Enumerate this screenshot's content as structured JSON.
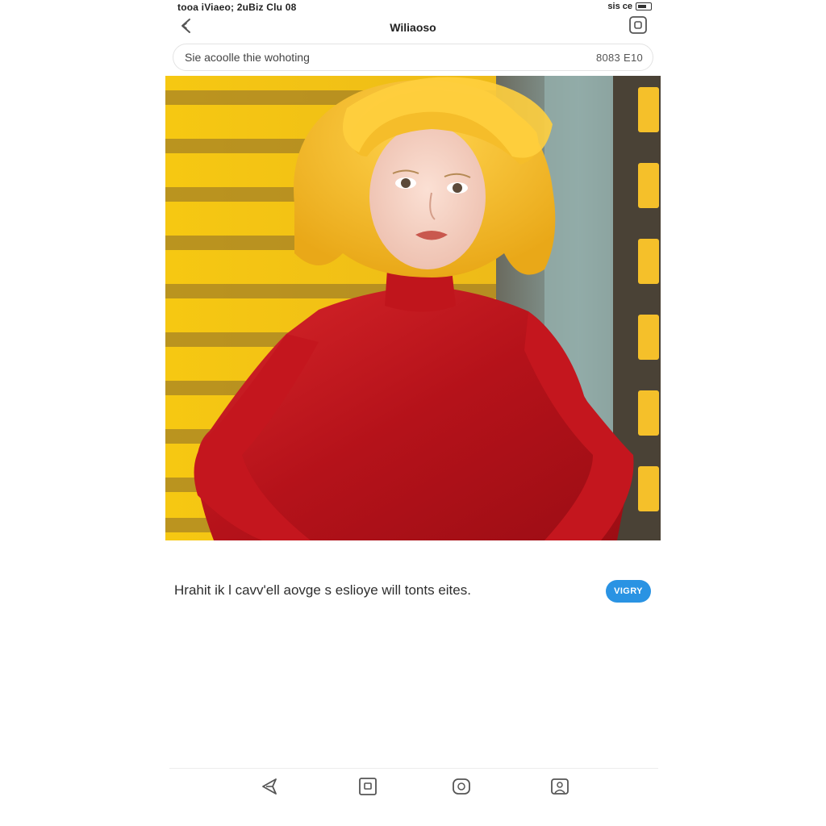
{
  "status_bar": {
    "left_text": "tooa iViaeo; 2uBiz Clu 08",
    "right_text": "sis ce"
  },
  "header": {
    "title": "Wiliaoso"
  },
  "search": {
    "placeholder": "Sie acoolle thie wohoting",
    "meta": "8083 E10"
  },
  "caption": {
    "text": "Hrahit ik l cavv'ell aovge s eslioye will tonts eites.",
    "button_label": "VIGRY"
  },
  "colors": {
    "accent": "#2a93e3",
    "background": "#ffffff"
  },
  "icons": {
    "back": "arrow-left-icon",
    "header_action": "square-icon",
    "nav": [
      "send-icon",
      "square-icon",
      "chat-icon",
      "profile-icon"
    ]
  }
}
